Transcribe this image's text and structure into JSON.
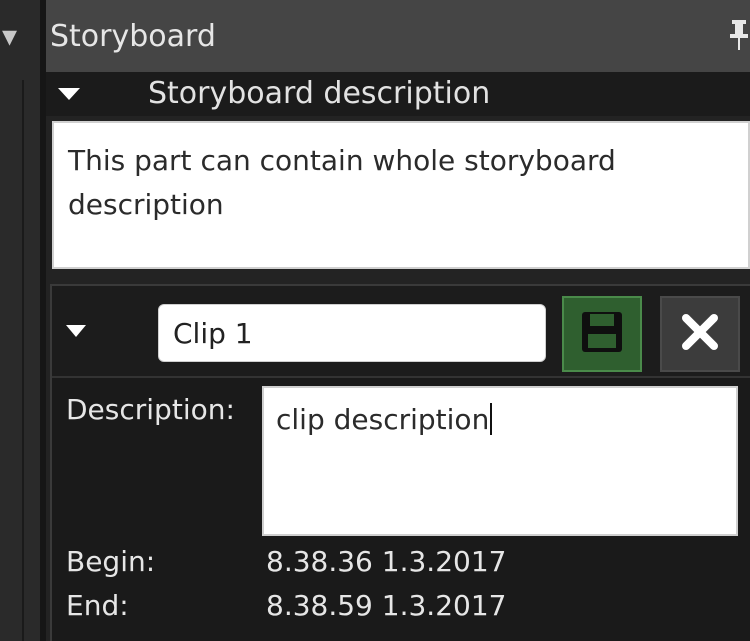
{
  "panel": {
    "title": "Storyboard",
    "pin_icon": "pin-icon"
  },
  "storyboard_section": {
    "header_label": "Storyboard description",
    "description": "This part can contain whole storyboard description"
  },
  "clip": {
    "name_value": "Clip 1",
    "save_icon": "save-disk-icon",
    "close_icon": "close-x-icon",
    "description_label": "Description:",
    "description_value": "clip description",
    "begin_label": "Begin:",
    "begin_value": "8.38.36 1.3.2017",
    "end_label": "End:",
    "end_value": "8.38.59 1.3.2017"
  },
  "colors": {
    "save_button_bg": "#2f5f2f",
    "panel_bg": "#232323",
    "titlebar_bg": "#454545"
  }
}
